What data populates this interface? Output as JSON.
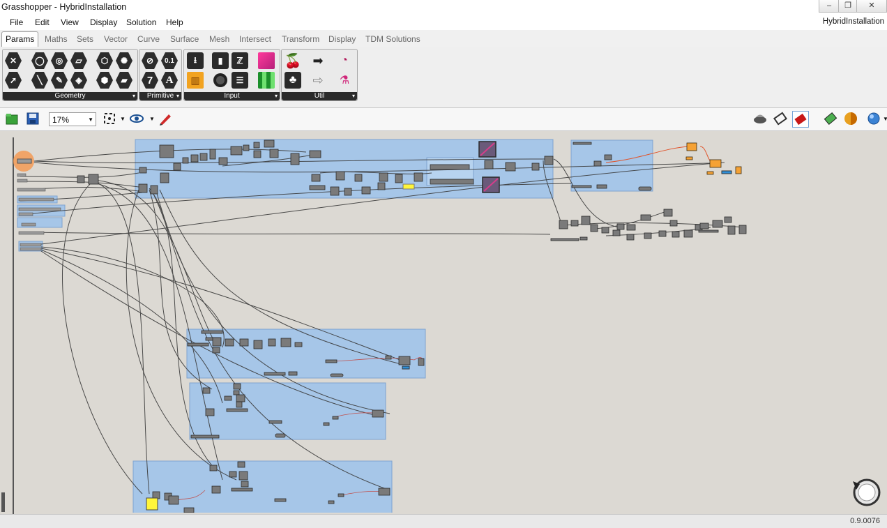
{
  "window": {
    "title": "Grasshopper - HybridInstallation",
    "minimize": "–",
    "restore": "❐",
    "close": "✕"
  },
  "menu": {
    "items": [
      "File",
      "Edit",
      "View",
      "Display",
      "Solution",
      "Help"
    ],
    "document_name": "HybridInstallation"
  },
  "tabs": [
    "Params",
    "Maths",
    "Sets",
    "Vector",
    "Curve",
    "Surface",
    "Mesh",
    "Intersect",
    "Transform",
    "Display",
    "TDM Solutions"
  ],
  "active_tab": "Params",
  "ribbon": {
    "panels": [
      {
        "label": "Geometry"
      },
      {
        "label": "Primitive"
      },
      {
        "label": "Input"
      },
      {
        "label": "Util"
      }
    ],
    "primitive_number_glyph": "0.1",
    "primitive_integer_glyph": "7",
    "primitive_text_glyph": "A"
  },
  "toolbar": {
    "zoom": "17%"
  },
  "status": {
    "version": "0.9.0076"
  },
  "colors": {
    "canvas": "#dcd9d3",
    "group_fill": "#a6c6e8",
    "wire": "#3a3a3a",
    "selected_component": "#f5a235",
    "panel_yellow": "#fff53a"
  }
}
